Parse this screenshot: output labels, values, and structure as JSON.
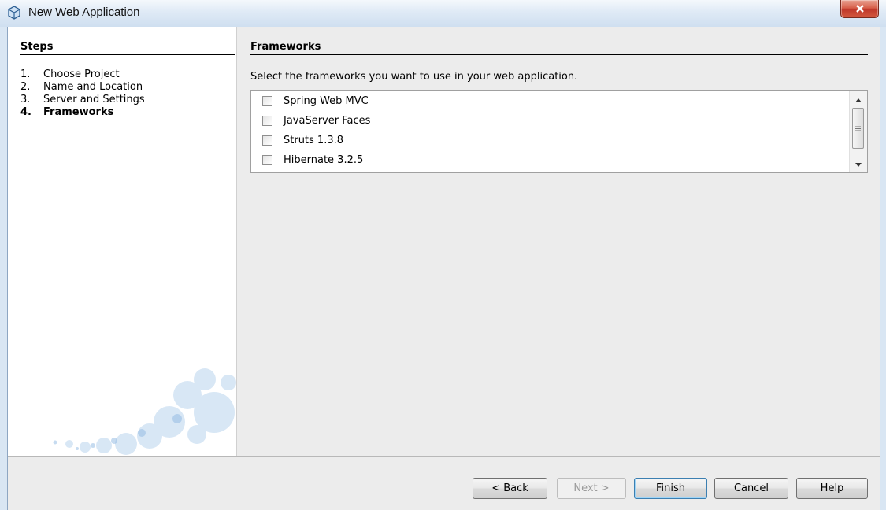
{
  "window": {
    "title": "New Web Application"
  },
  "steps": {
    "heading": "Steps",
    "items": [
      {
        "num": "1.",
        "label": "Choose Project",
        "current": false
      },
      {
        "num": "2.",
        "label": "Name and Location",
        "current": false
      },
      {
        "num": "3.",
        "label": "Server and Settings",
        "current": false
      },
      {
        "num": "4.",
        "label": "Frameworks",
        "current": true
      }
    ]
  },
  "content": {
    "heading": "Frameworks",
    "instruction": "Select the frameworks you want to use in your web application.",
    "frameworks": [
      {
        "label": "Spring Web MVC",
        "checked": false
      },
      {
        "label": "JavaServer Faces",
        "checked": false
      },
      {
        "label": "Struts 1.3.8",
        "checked": false
      },
      {
        "label": "Hibernate 3.2.5",
        "checked": false
      }
    ]
  },
  "buttons": {
    "back": "< Back",
    "next": "Next >",
    "finish": "Finish",
    "cancel": "Cancel",
    "help": "Help"
  },
  "icons": {
    "app": "netbeans-cube-icon",
    "close": "close-icon",
    "scroll_up": "arrow-up-icon",
    "scroll_down": "arrow-down-icon",
    "grip": "grip-icon"
  }
}
